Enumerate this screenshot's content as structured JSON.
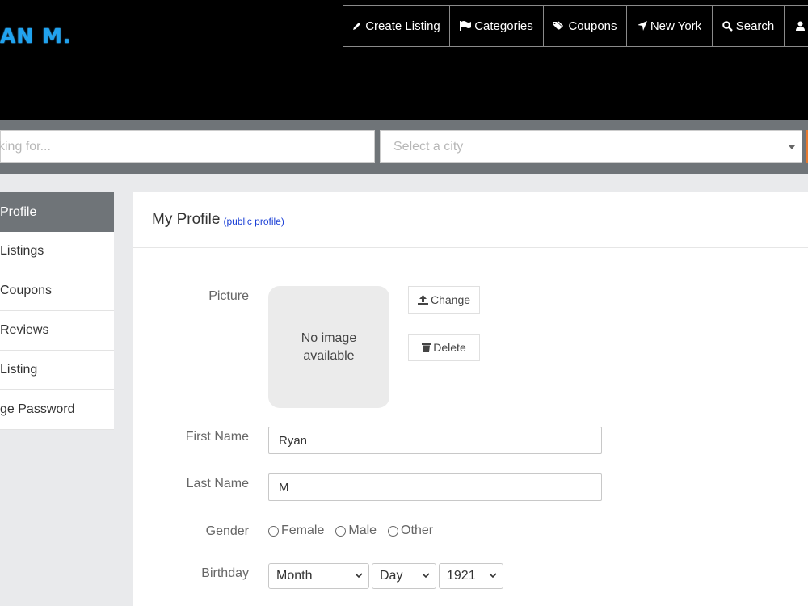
{
  "header": {
    "logo_text": "AN M.",
    "nav": [
      {
        "label": "Create Listing",
        "icon": "pencil-icon"
      },
      {
        "label": "Categories",
        "icon": "flag-icon"
      },
      {
        "label": "Coupons",
        "icon": "tags-icon"
      },
      {
        "label": "New York",
        "icon": "location-arrow-icon"
      },
      {
        "label": "Search",
        "icon": "search-icon"
      },
      {
        "label": "",
        "icon": "user-icon"
      }
    ]
  },
  "search": {
    "keyword_placeholder": "king for...",
    "city_placeholder": "Select a city"
  },
  "sidebar": {
    "items": [
      {
        "label": "Profile"
      },
      {
        "label": "Listings"
      },
      {
        "label": "Coupons"
      },
      {
        "label": "Reviews"
      },
      {
        "label": "Listing"
      },
      {
        "label": "ge Password"
      }
    ]
  },
  "profile": {
    "title": "My Profile",
    "public_link": "(public profile)",
    "picture_label": "Picture",
    "no_image_line1": "No image",
    "no_image_line2": "available",
    "change_label": "Change",
    "delete_label": "Delete",
    "first_name_label": "First Name",
    "first_name_value": "Ryan",
    "last_name_label": "Last Name",
    "last_name_value": "M",
    "gender_label": "Gender",
    "gender_options": [
      "Female",
      "Male",
      "Other"
    ],
    "birthday_label": "Birthday",
    "month_value": "Month",
    "day_value": "Day",
    "year_value": "1921"
  },
  "colors": {
    "header_bg": "#000000",
    "logo": "#1fa3f0",
    "searchbar_bg": "#6f7478",
    "sidebar_active_bg": "#6f7478",
    "link": "#1a3fd6",
    "search_button_accent": "#e8792e"
  }
}
